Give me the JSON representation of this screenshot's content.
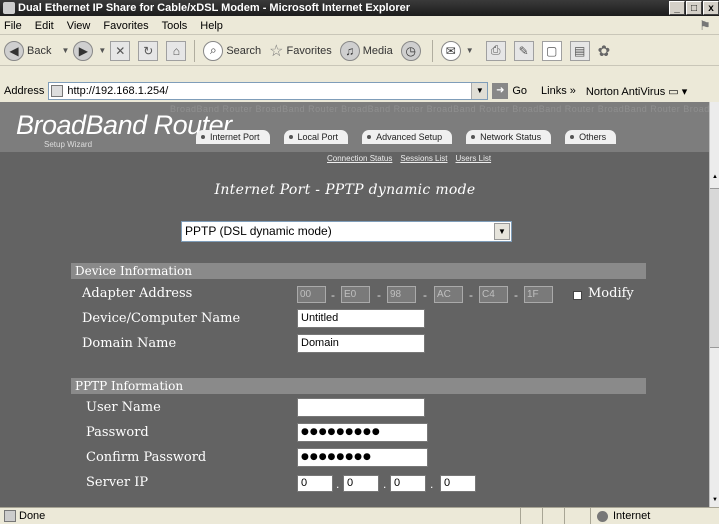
{
  "window": {
    "title": "Dual Ethernet IP Share for Cable/xDSL Modem - Microsoft Internet Explorer",
    "buttons": [
      "_",
      "□",
      "x"
    ]
  },
  "menu": [
    "File",
    "Edit",
    "View",
    "Favorites",
    "Tools",
    "Help"
  ],
  "toolbar": {
    "back": "Back",
    "search": "Search",
    "favorites": "Favorites",
    "media": "Media"
  },
  "address": {
    "label": "Address",
    "url": "http://192.168.1.254/",
    "go": "Go",
    "links": "Links",
    "norton": "Norton AntiVirus"
  },
  "router": {
    "brand": "BroadBand Router",
    "watermark": "BroadBand Router BroadBand Router BroadBand Router BroadBand Router BroadBand Router BroadBand Router BroadBand Router",
    "setup_wizard": "Setup Wizard",
    "tabs": [
      "Internet Port",
      "Local Port",
      "Advanced Setup",
      "Network Status",
      "Others"
    ],
    "sublinks": [
      "Connection Status",
      "Sessions List",
      "Users List"
    ],
    "page_title": "Internet Port - PPTP dynamic mode",
    "mode": "PPTP (DSL dynamic mode)",
    "device_section": {
      "title": "Device Information",
      "adapter_label": "Adapter Address",
      "mac": [
        "00",
        "E0",
        "98",
        "AC",
        "C4",
        "1F"
      ],
      "modify_label": "Modify",
      "computer_name_label": "Device/Computer Name",
      "computer_name": "Untitled",
      "domain_label": "Domain Name",
      "domain": "Domain"
    },
    "pptp_section": {
      "title": "PPTP Information",
      "user_label": "User Name",
      "user": "",
      "password_label": "Password",
      "password": "●●●●●●●●●",
      "confirm_label": "Confirm Password",
      "confirm": "●●●●●●●●",
      "server_label": "Server IP",
      "server_ip": [
        "0",
        "0",
        "0",
        "0"
      ]
    }
  },
  "status": {
    "text": "Done",
    "zone": "Internet"
  }
}
